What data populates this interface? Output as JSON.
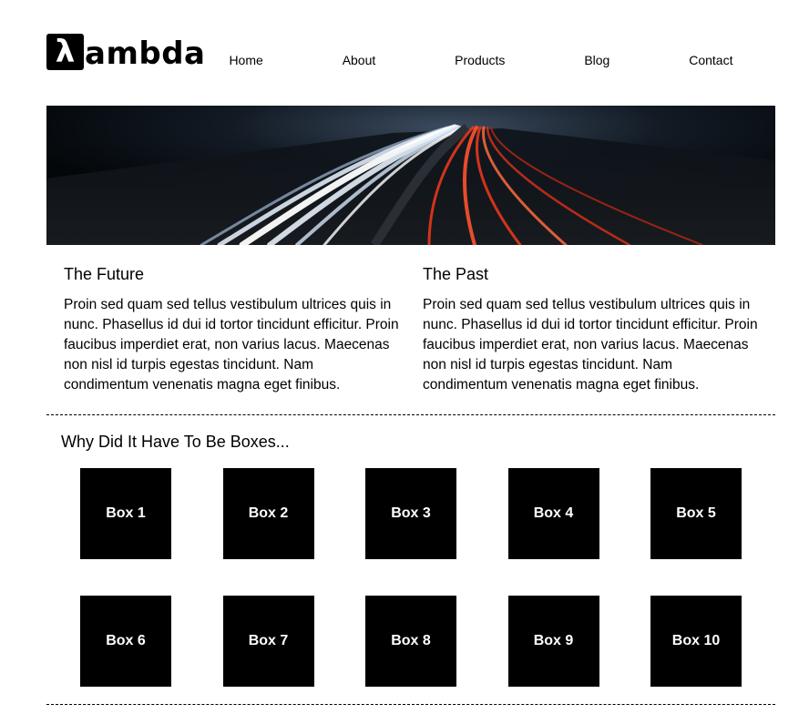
{
  "header": {
    "logo_mark": "λ",
    "logo_text": "ambda",
    "nav": [
      "Home",
      "About",
      "Products",
      "Blog",
      "Contact"
    ]
  },
  "columns": [
    {
      "title": "The Future",
      "body": "Proin sed quam sed tellus vestibulum ultrices quis in nunc. Phasellus id dui id tortor tincidunt efficitur. Proin faucibus imperdiet erat, non varius lacus. Maecenas non nisl id turpis egestas tincidunt. Nam condimentum venenatis magna eget finibus."
    },
    {
      "title": "The Past",
      "body": "Proin sed quam sed tellus vestibulum ultrices quis in nunc. Phasellus id dui id tortor tincidunt efficitur. Proin faucibus imperdiet erat, non varius lacus. Maecenas non nisl id turpis egestas tincidunt. Nam condimentum venenatis magna eget finibus."
    }
  ],
  "boxes_section": {
    "title": "Why Did It Have To Be Boxes...",
    "boxes": [
      "Box 1",
      "Box 2",
      "Box 3",
      "Box 4",
      "Box 5",
      "Box 6",
      "Box 7",
      "Box 8",
      "Box 9",
      "Box 10"
    ]
  },
  "colors": {
    "background": "#ffffff",
    "box": "#000000",
    "box_text": "#ffffff",
    "light_trail_white": "#dfe9f5",
    "light_trail_red": "#e8361c"
  }
}
